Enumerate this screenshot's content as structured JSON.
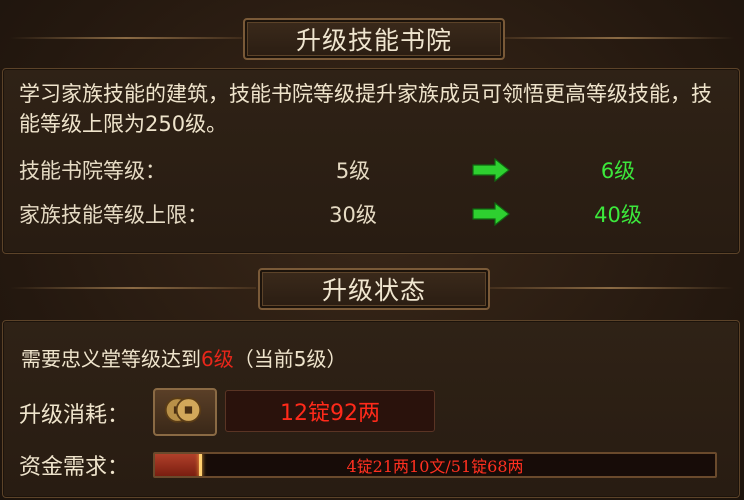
{
  "section1": {
    "title": "升级技能书院",
    "description": "学习家族技能的建筑，技能书院等级提升家族成员可领悟更高等级技能，技能等级上限为250级。",
    "rows": [
      {
        "label": "技能书院等级：",
        "current": "5级",
        "next": "6级"
      },
      {
        "label": "家族技能等级上限：",
        "current": "30级",
        "next": "40级"
      }
    ]
  },
  "section2": {
    "title": "升级状态",
    "requirement_prefix": "需要忠义堂等级达到",
    "requirement_level": "6级",
    "requirement_suffix": "（当前5级）",
    "cost_label": "升级消耗：",
    "cost_value": "12锭92两",
    "fund_label": "资金需求：",
    "fund_text": "4锭21两10文/51锭68两",
    "fund_progress": 0.082
  },
  "colors": {
    "next_level": "#3ce83c",
    "requirement": "#e8261a",
    "cost": "#ff2a1a"
  },
  "icons": {
    "arrow": "green-arrow-icon",
    "coin": "copper-coins-icon"
  }
}
